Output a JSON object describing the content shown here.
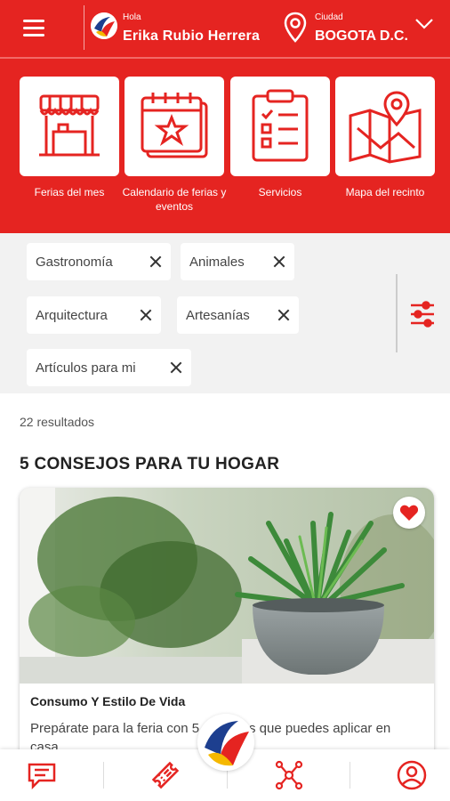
{
  "header": {
    "greeting": "Hola",
    "user_name": "Erika Rubio Herrera",
    "city_label": "Ciudad",
    "city_value": "BOGOTA D.C."
  },
  "quick_access": [
    {
      "label": "Ferias del mes",
      "icon": "market-stall-icon"
    },
    {
      "label": "Calendario de ferias y eventos",
      "icon": "calendar-star-icon"
    },
    {
      "label": "Servicios",
      "icon": "checklist-icon"
    },
    {
      "label": "Mapa del recinto",
      "icon": "map-pin-icon"
    }
  ],
  "filters": [
    {
      "label": "Gastronomía"
    },
    {
      "label": "Animales"
    },
    {
      "label": "Arquitectura"
    },
    {
      "label": "Artesanías"
    },
    {
      "label": "Artículos para mi"
    }
  ],
  "results": {
    "count_text": "22 resultados",
    "section_title": "5 CONSEJOS PARA TU HOGAR"
  },
  "article": {
    "category": "Consumo Y Estilo De Vida",
    "excerpt": "Prepárate para la feria con 5 consejos que puedes aplicar en casa"
  },
  "colors": {
    "brand_red": "#e52421",
    "background_gray": "#f2f2f2"
  },
  "bottom_nav": [
    {
      "icon": "chat-icon"
    },
    {
      "icon": "ticket-icon"
    },
    {
      "icon": "brand-logo"
    },
    {
      "icon": "network-icon"
    },
    {
      "icon": "profile-icon"
    }
  ]
}
